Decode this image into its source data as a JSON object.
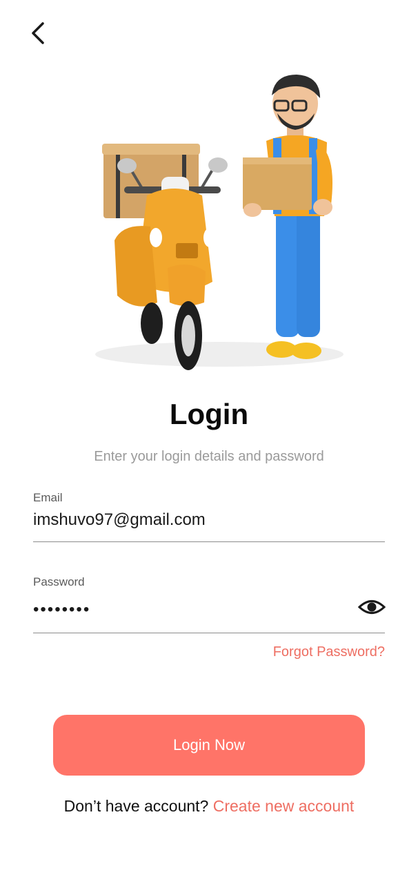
{
  "header": {
    "back_icon": "chevron-left-icon"
  },
  "hero": {
    "illustration": "delivery-person-with-scooter-illustration"
  },
  "login": {
    "title": "Login",
    "subtitle": "Enter your login details and password"
  },
  "form": {
    "email_label": "Email",
    "email_value": "imshuvo97@gmail.com",
    "password_label": "Password",
    "password_value": "12345678",
    "password_visibility_icon": "eye-icon",
    "forgot_password": "Forgot Password?"
  },
  "actions": {
    "login_button": "Login Now",
    "signup_prompt": "Don’t have account?",
    "signup_link": "Create new account"
  },
  "colors": {
    "accent": "#ff7468",
    "link": "#ee6e62",
    "muted": "#9a9a9a"
  }
}
